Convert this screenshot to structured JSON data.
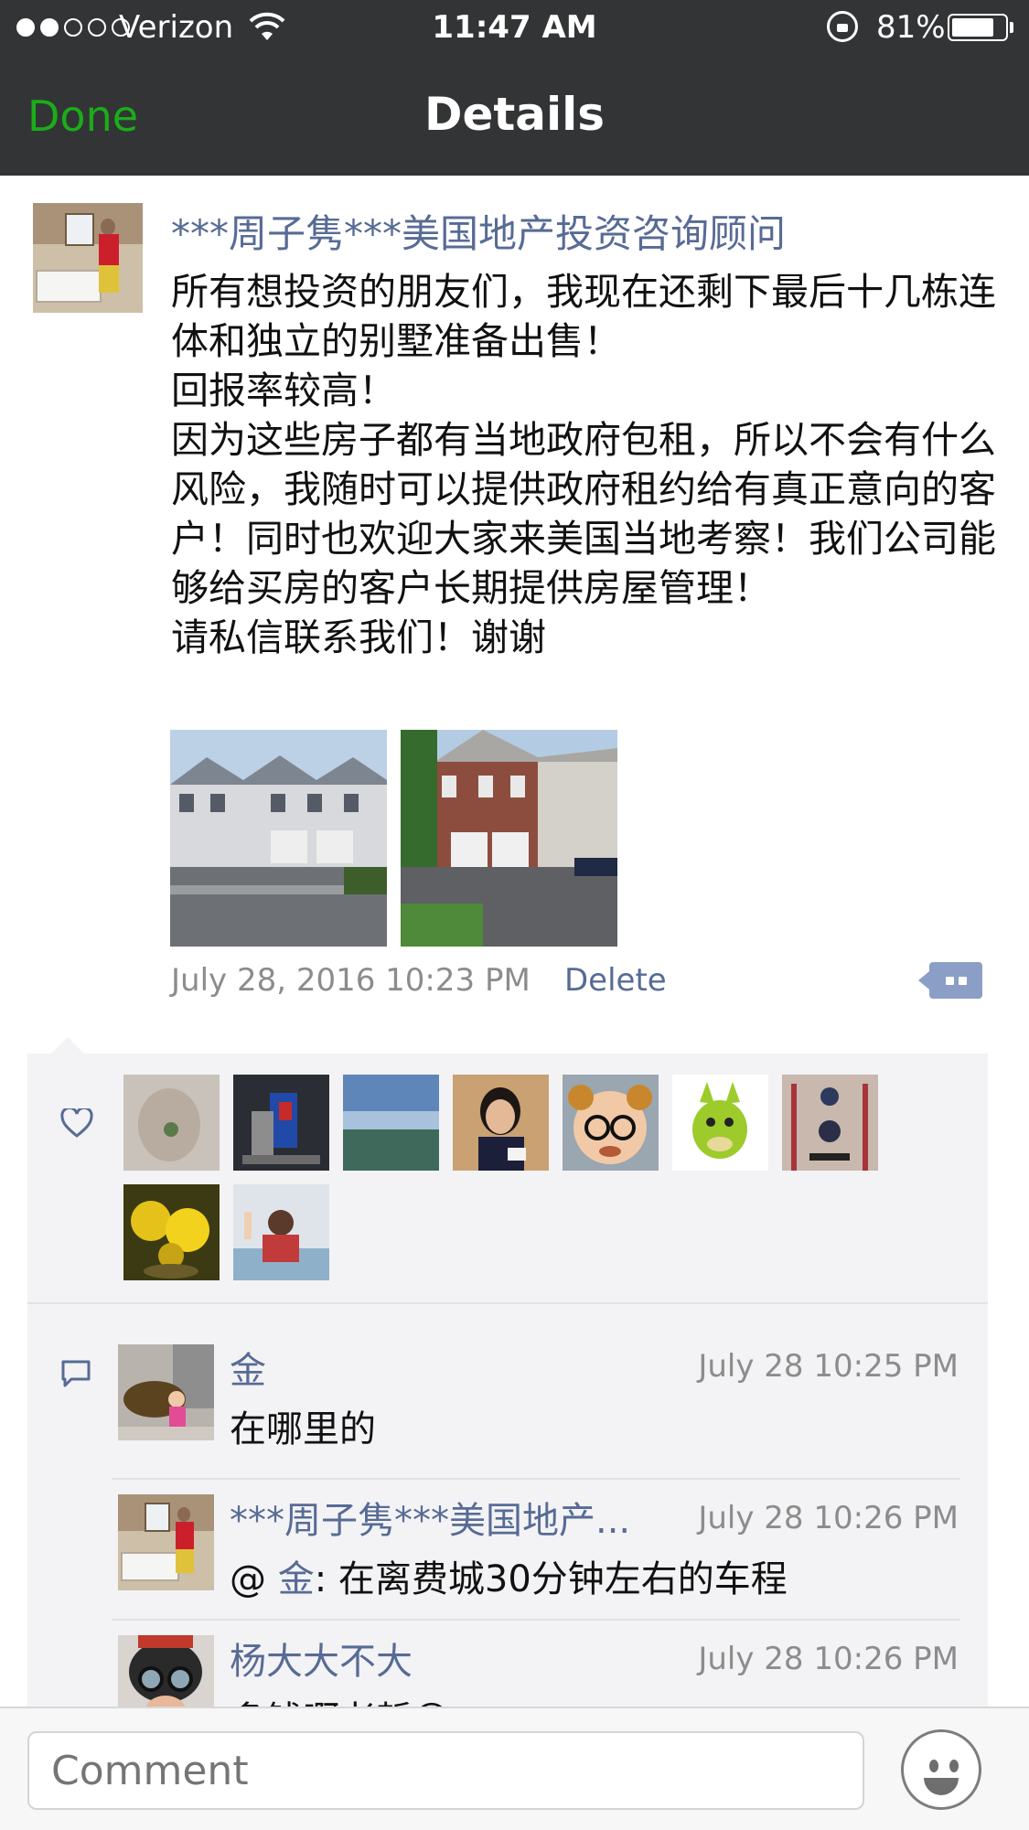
{
  "status_bar": {
    "carrier": "Verizon",
    "time": "11:47 AM",
    "battery": "81%",
    "battery_level": 0.81,
    "signal_bars_filled": 2,
    "signal_bars_total": 5
  },
  "nav": {
    "done_label": "Done",
    "title": "Details"
  },
  "post": {
    "author": "***周子隽***美国地产投资咨询顾问",
    "text_lines": [
      "所有想投资的朋友们，我现在还剩下最后十几栋连体和独立的别墅准备出售！",
      "回报率较高！",
      "因为这些房子都有当地政府包租，所以不会有什么风险，我随时可以提供政府租约给有真正意向的客户！同时也欢迎大家来美国当地考察！我们公司能够给买房的客户长期提供房屋管理！",
      "请私信联系我们！谢谢"
    ],
    "timestamp": "July 28, 2016 10:23 PM",
    "delete_label": "Delete",
    "photos": [
      "townhouse-photo-1",
      "townhouse-photo-2"
    ]
  },
  "likes": {
    "icon": "heart-icon",
    "count": 9
  },
  "comments": [
    {
      "name": "金",
      "time": "July 28 10:25 PM",
      "text": "在哪里的"
    },
    {
      "name": "***周子隽***美国地产...",
      "time": "July 28 10:26 PM",
      "text_prefix": "@ ",
      "mention": "金",
      "text": ": 在离费城30分钟左右的车程"
    },
    {
      "name": "杨大大不大",
      "time": "July 28 10:26 PM",
      "text": "多钱啊老哲😎"
    }
  ],
  "input": {
    "placeholder": "Comment"
  },
  "colors": {
    "nav_bg": "#333436",
    "done_green": "#1aad19",
    "link_blue": "#576b95",
    "panel_bg": "#f3f3f5"
  }
}
